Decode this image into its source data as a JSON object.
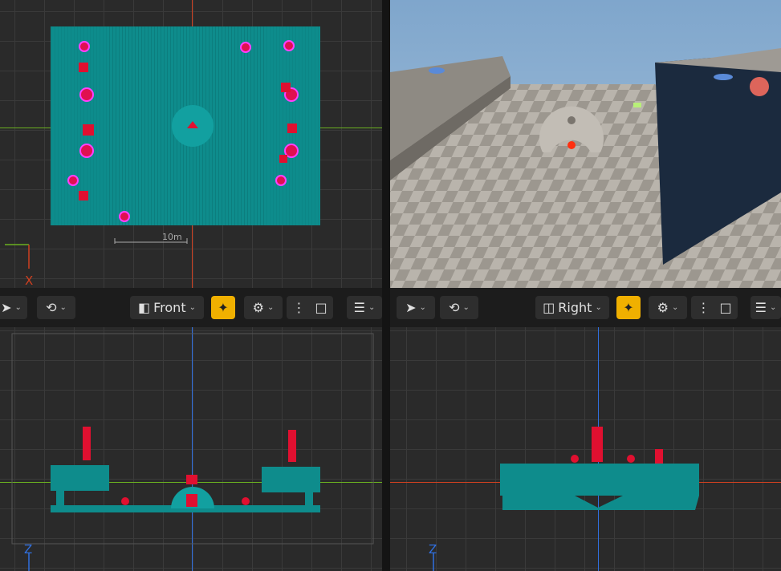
{
  "viewports": {
    "top": {
      "scale_label": "10m",
      "axis_label": "X"
    },
    "front": {
      "axis_label": "Z"
    },
    "right": {
      "axis_label": "Z"
    }
  },
  "toolbars": {
    "front": {
      "view_label": "Front"
    },
    "right": {
      "view_label": "Right"
    }
  },
  "colors": {
    "accent": "#f0b000",
    "mesh": "#0e8c8c",
    "actor": "#e01050",
    "axis_x": "#d04020",
    "axis_y": "#6ab020",
    "axis_z": "#3070e0"
  },
  "icons": [
    "select-icon",
    "snap-icon",
    "view-mode-icon",
    "realtime-icon",
    "settings-icon",
    "more-icon",
    "maximize-icon",
    "menu-icon"
  ]
}
